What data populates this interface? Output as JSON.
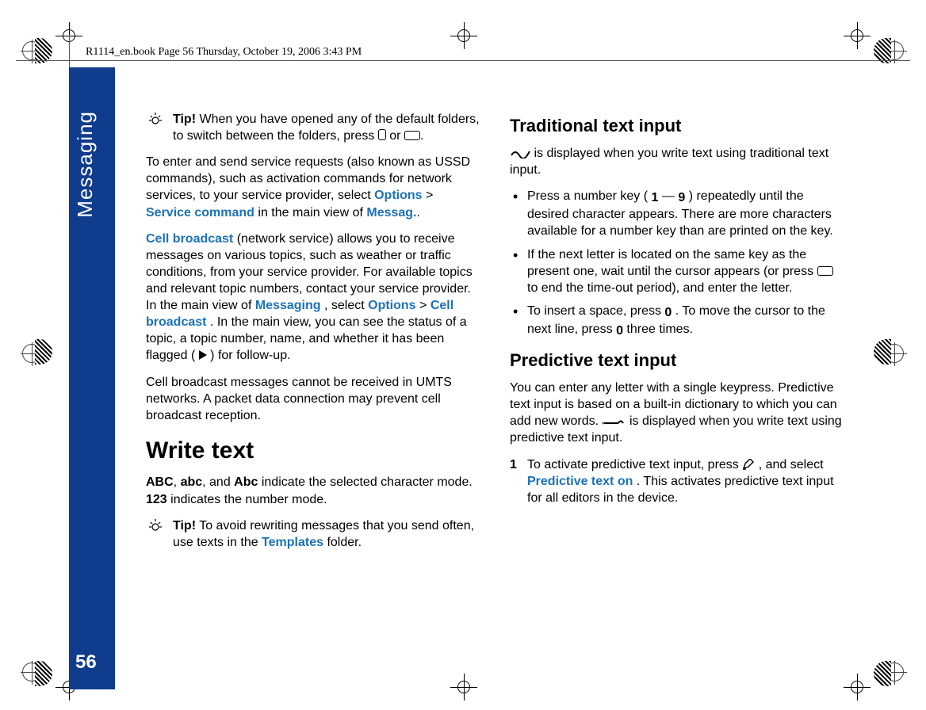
{
  "book_line": "R1114_en.book  Page 56  Thursday, October 19, 2006  3:43 PM",
  "side_label": "Messaging",
  "page_number": "56",
  "left": {
    "tip1_label": "Tip!",
    "tip1_text": " When you have opened any of the default folders, to switch between the folders, press ",
    "tip1_or": " or ",
    "tip1_end": ".",
    "p1a": "To enter and send service requests (also known as USSD commands), such as activation commands for network services, to your service provider, select ",
    "options": "Options",
    "gt": " > ",
    "svc_cmd": "Service command",
    "p1b": " in the main view of ",
    "messag": "Messag.",
    "p1c": ".",
    "cell_b": "Cell broadcast",
    "p2a": " (network service) allows you to receive messages on various topics, such as weather or traffic conditions, from your service provider. For available topics and relevant topic numbers, contact your service provider. In the main view of ",
    "messaging": "Messaging",
    "p2b": ", select ",
    "options2": "Options",
    "gt2": " > ",
    "cellb2": "Cell broadcast",
    "p2c": ". In the main view, you can see the status of a topic, a topic number, name, and whether it has been flagged (",
    "p2d": ") for follow-up.",
    "p3": "Cell broadcast messages cannot be received in UMTS networks. A packet data connection may prevent cell broadcast reception.",
    "h1": "Write text",
    "p4_abc_upper": "ABC",
    "p4_s1": ", ",
    "p4_abc_lower": "abc",
    "p4_s2": ", and ",
    "p4_abc_cap": "Abc",
    "p4_s3": " indicate the selected character mode. ",
    "p4_123": "123",
    "p4_s4": " indicates the number mode.",
    "tip2_label": "Tip!",
    "tip2_text": " To avoid rewriting messages that you send often, use texts in the ",
    "templates": "Templates",
    "tip2_end": " folder."
  },
  "right": {
    "h2a": "Traditional text input",
    "p1a": " is displayed when you write text using traditional text input.",
    "li1a": "Press a number key (",
    "li1_dash": " — ",
    "li1b": ") repeatedly until the desired character appears. There are more characters available for a number key than are printed on the key.",
    "li2a": "If the next letter is located on the same key as the present one, wait until the cursor appears (or press ",
    "li2b": " to end the time-out period), and enter the letter.",
    "li3a": "To insert a space, press ",
    "li3b": ". To move the cursor to the next line, press ",
    "li3c": " three times.",
    "h2b": "Predictive text input",
    "p2a": "You can enter any letter with a single keypress. Predictive text input is based on a built-in dictionary to which you can add new words. ",
    "p2b": " is displayed when you write text using predictive text input.",
    "ol_num": "1",
    "ol1a": "To activate predictive text input, press ",
    "ol1b": ", and select ",
    "pred_on": "Predictive text on",
    "ol1c": ". This activates predictive text input for all editors in the device."
  },
  "glyphs": {
    "one": "1",
    "nine": "9",
    "zero": "0",
    "zero2": "0"
  }
}
